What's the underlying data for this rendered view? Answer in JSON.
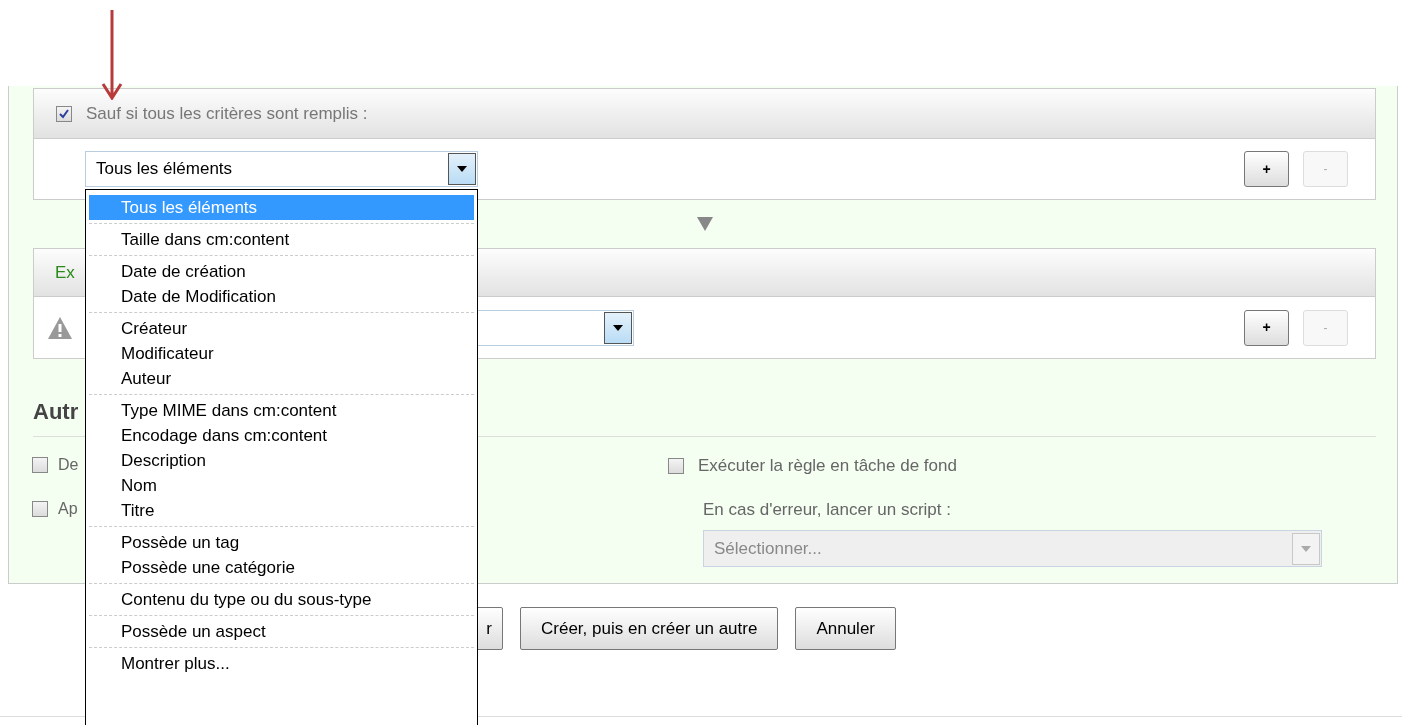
{
  "unless_card": {
    "checked": true,
    "label": "Sauf si tous les critères sont remplis :",
    "select_value": "Tous les éléments",
    "add_button": "+",
    "remove_button": "-",
    "remove_disabled": true
  },
  "action_card": {
    "header": "Ex",
    "add_button": "+",
    "remove_button": "-",
    "remove_disabled": true
  },
  "other_options": {
    "heading": "Autr",
    "left_options": [
      {
        "label": "De",
        "checked": false
      },
      {
        "label": "Ap",
        "checked": false
      }
    ],
    "background": {
      "label": "Exécuter la règle en tâche de fond",
      "checked": false
    },
    "error_script_label": "En cas d'erreur, lancer un script :",
    "error_script_placeholder": "Sélectionner..."
  },
  "buttons": [
    {
      "label": "r"
    },
    {
      "label": "Créer, puis en créer un autre"
    },
    {
      "label": "Annuler"
    }
  ],
  "menu": {
    "groups": [
      [
        {
          "label": "Tous les éléments",
          "selected": true
        }
      ],
      [
        {
          "label": "Taille dans cm:content",
          "selected": false
        }
      ],
      [
        {
          "label": "Date de création",
          "selected": false
        },
        {
          "label": "Date de Modification",
          "selected": false
        }
      ],
      [
        {
          "label": "Créateur",
          "selected": false
        },
        {
          "label": "Modificateur",
          "selected": false
        },
        {
          "label": "Auteur",
          "selected": false
        }
      ],
      [
        {
          "label": "Type MIME dans cm:content",
          "selected": false
        },
        {
          "label": "Encodage dans cm:content",
          "selected": false
        },
        {
          "label": "Description",
          "selected": false
        },
        {
          "label": "Nom",
          "selected": false
        },
        {
          "label": "Titre",
          "selected": false
        }
      ],
      [
        {
          "label": "Possède un tag",
          "selected": false
        },
        {
          "label": "Possède une catégorie",
          "selected": false
        }
      ],
      [
        {
          "label": "Contenu du type ou du sous-type",
          "selected": false
        }
      ],
      [
        {
          "label": "Possède un aspect",
          "selected": false
        }
      ],
      [
        {
          "label": "Montrer plus...",
          "selected": false
        }
      ]
    ]
  }
}
